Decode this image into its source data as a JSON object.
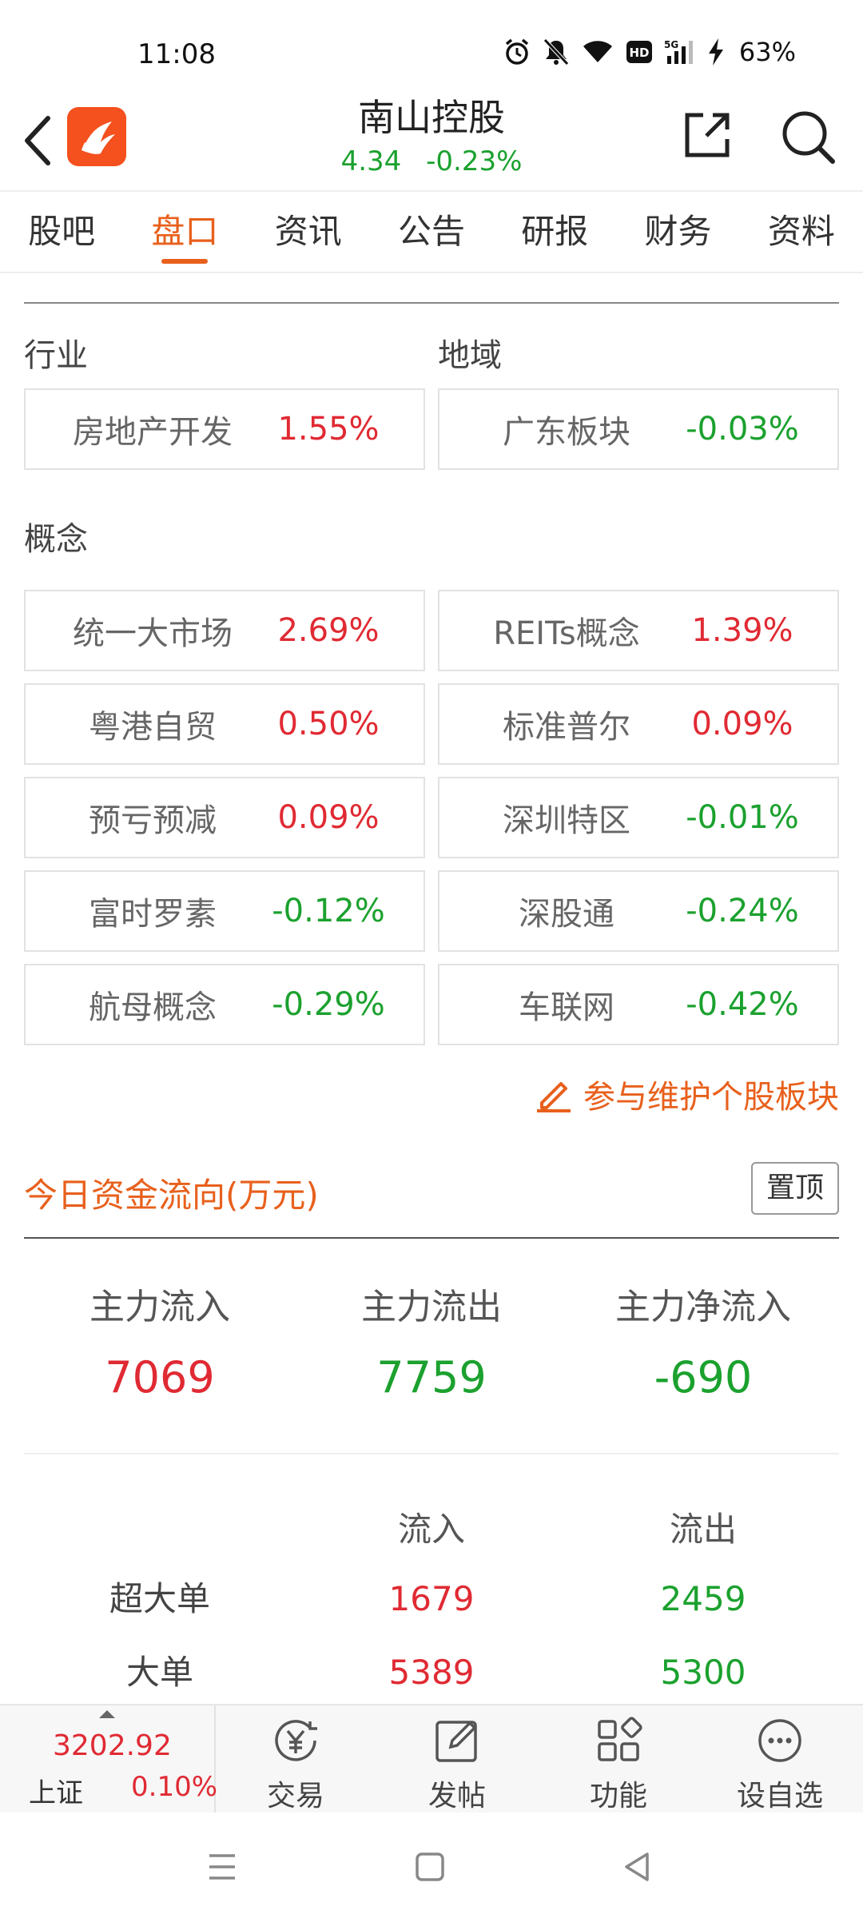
{
  "status_bar": {
    "time": "11:08",
    "battery": "63%",
    "icons": [
      "alarm-icon",
      "mute-icon",
      "wifi-icon",
      "hd-icon",
      "signal-5g-icon",
      "charging-icon"
    ]
  },
  "header": {
    "stock_name": "南山控股",
    "price": "4.34",
    "change_pct": "-0.23%",
    "quote_color": "#1ba12e",
    "logo_color": "#f4511e"
  },
  "tabs": [
    {
      "label": "股吧",
      "active": false
    },
    {
      "label": "盘口",
      "active": true
    },
    {
      "label": "资讯",
      "active": false
    },
    {
      "label": "公告",
      "active": false
    },
    {
      "label": "研报",
      "active": false
    },
    {
      "label": "财务",
      "active": false
    },
    {
      "label": "资料",
      "active": false
    }
  ],
  "industry": {
    "label": "行业",
    "name": "房地产开发",
    "pct": "1.55%"
  },
  "region": {
    "label": "地域",
    "name": "广东板块",
    "pct": "-0.03%"
  },
  "concepts": {
    "label": "概念",
    "items": [
      {
        "name": "统一大市场",
        "pct": "2.69%"
      },
      {
        "name": "REITs概念",
        "pct": "1.39%"
      },
      {
        "name": "粤港自贸",
        "pct": "0.50%"
      },
      {
        "name": "标准普尔",
        "pct": "0.09%"
      },
      {
        "name": "预亏预减",
        "pct": "0.09%"
      },
      {
        "name": "深圳特区",
        "pct": "-0.01%"
      },
      {
        "name": "富时罗素",
        "pct": "-0.12%"
      },
      {
        "name": "深股通",
        "pct": "-0.24%"
      },
      {
        "name": "航母概念",
        "pct": "-0.29%"
      },
      {
        "name": "车联网",
        "pct": "-0.42%"
      }
    ]
  },
  "maintain_link": "参与维护个股板块",
  "flow": {
    "title": "今日资金流向(万元)",
    "pin_label": "置顶",
    "main_inflow_label": "主力流入",
    "main_inflow": "7069",
    "main_outflow_label": "主力流出",
    "main_outflow": "7759",
    "main_net_label": "主力净流入",
    "main_net": "-690",
    "col_in": "流入",
    "col_out": "流出",
    "rows": [
      {
        "name": "超大单",
        "in": "1679",
        "out": "2459"
      },
      {
        "name": "大单",
        "in": "5389",
        "out": "5300"
      }
    ]
  },
  "colors": {
    "up": "#e02a33",
    "down": "#1ba12e",
    "accent": "#e8601c"
  },
  "bottom_bar": {
    "index_value": "3202.92",
    "index_name": "上证",
    "index_pct": "0.10%",
    "nav": [
      {
        "label": "交易",
        "icon": "trade-yen-icon"
      },
      {
        "label": "发帖",
        "icon": "edit-post-icon"
      },
      {
        "label": "功能",
        "icon": "grid-apps-icon"
      },
      {
        "label": "设自选",
        "icon": "more-dots-icon"
      }
    ]
  }
}
